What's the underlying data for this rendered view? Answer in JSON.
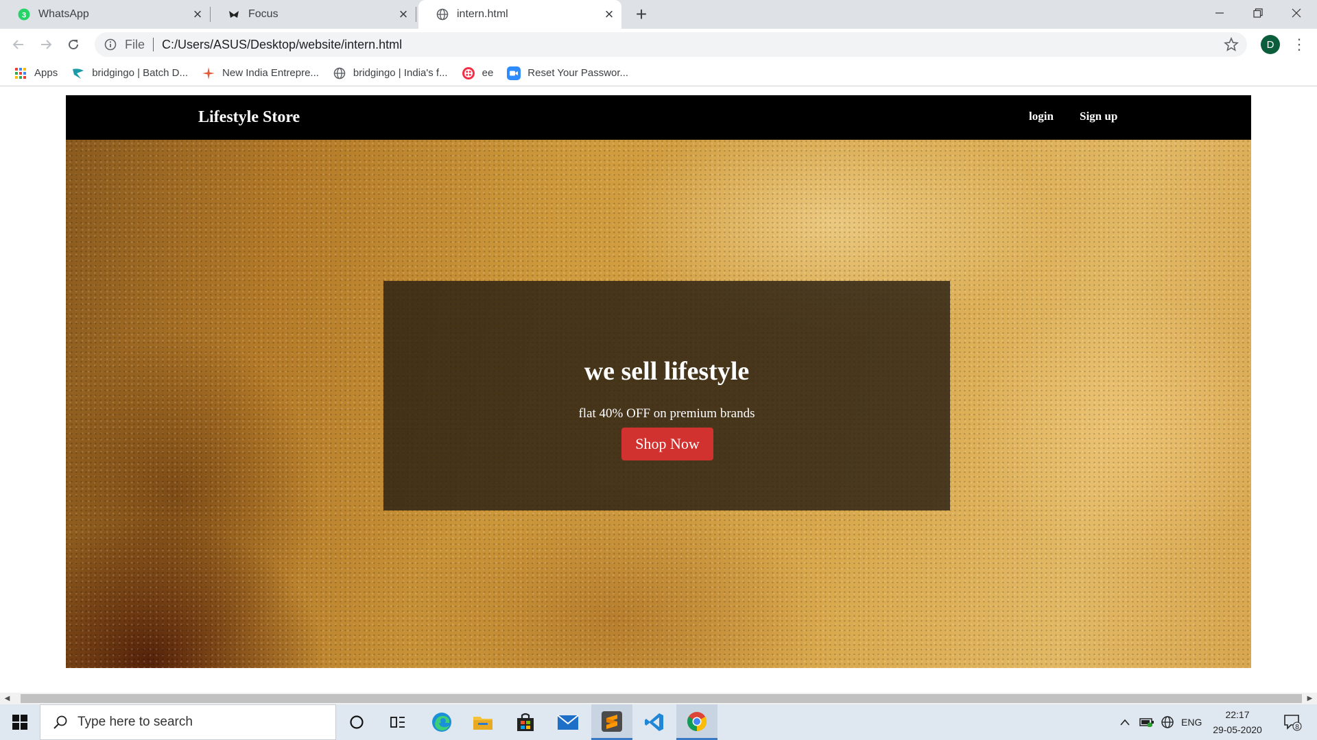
{
  "browser": {
    "tabs": [
      {
        "title": "WhatsApp",
        "icon": "whatsapp-icon",
        "badge": "3",
        "active": false
      },
      {
        "title": "Focus",
        "icon": "focus-icon",
        "active": false
      },
      {
        "title": "intern.html",
        "icon": "globe-icon",
        "active": true
      }
    ],
    "address": {
      "scheme": "File",
      "url": "C:/Users/ASUS/Desktop/website/intern.html"
    },
    "profile_initial": "D",
    "bookmarks": [
      {
        "label": "Apps",
        "icon": "apps-grid-icon"
      },
      {
        "label": "bridgingo | Batch D...",
        "icon": "bridgingo-icon"
      },
      {
        "label": "New India Entrepre...",
        "icon": "spark-icon"
      },
      {
        "label": "bridgingo | India's f...",
        "icon": "globe-icon"
      },
      {
        "label": "ee",
        "icon": "twilio-icon"
      },
      {
        "label": "Reset Your Passwor...",
        "icon": "zoom-icon"
      }
    ]
  },
  "site": {
    "brand": "Lifestyle Store",
    "nav": {
      "login": "login",
      "signup": "Sign up"
    },
    "hero": {
      "headline": "we sell lifestyle",
      "subline": "flat 40% OFF on premium brands",
      "cta": "Shop Now"
    },
    "colors": {
      "nav_bg": "#000000",
      "cta": "#d1312f",
      "hero_base": "#cf9a3c"
    }
  },
  "taskbar": {
    "search_placeholder": "Type here to search",
    "apps": [
      "cortana-icon",
      "task-view-icon",
      "edge-icon",
      "file-explorer-icon",
      "store-icon",
      "mail-icon",
      "sublime-text-icon",
      "vscode-icon",
      "chrome-icon"
    ],
    "language": "ENG",
    "time": "22:17",
    "date": "29-05-2020",
    "notifications": "8"
  }
}
